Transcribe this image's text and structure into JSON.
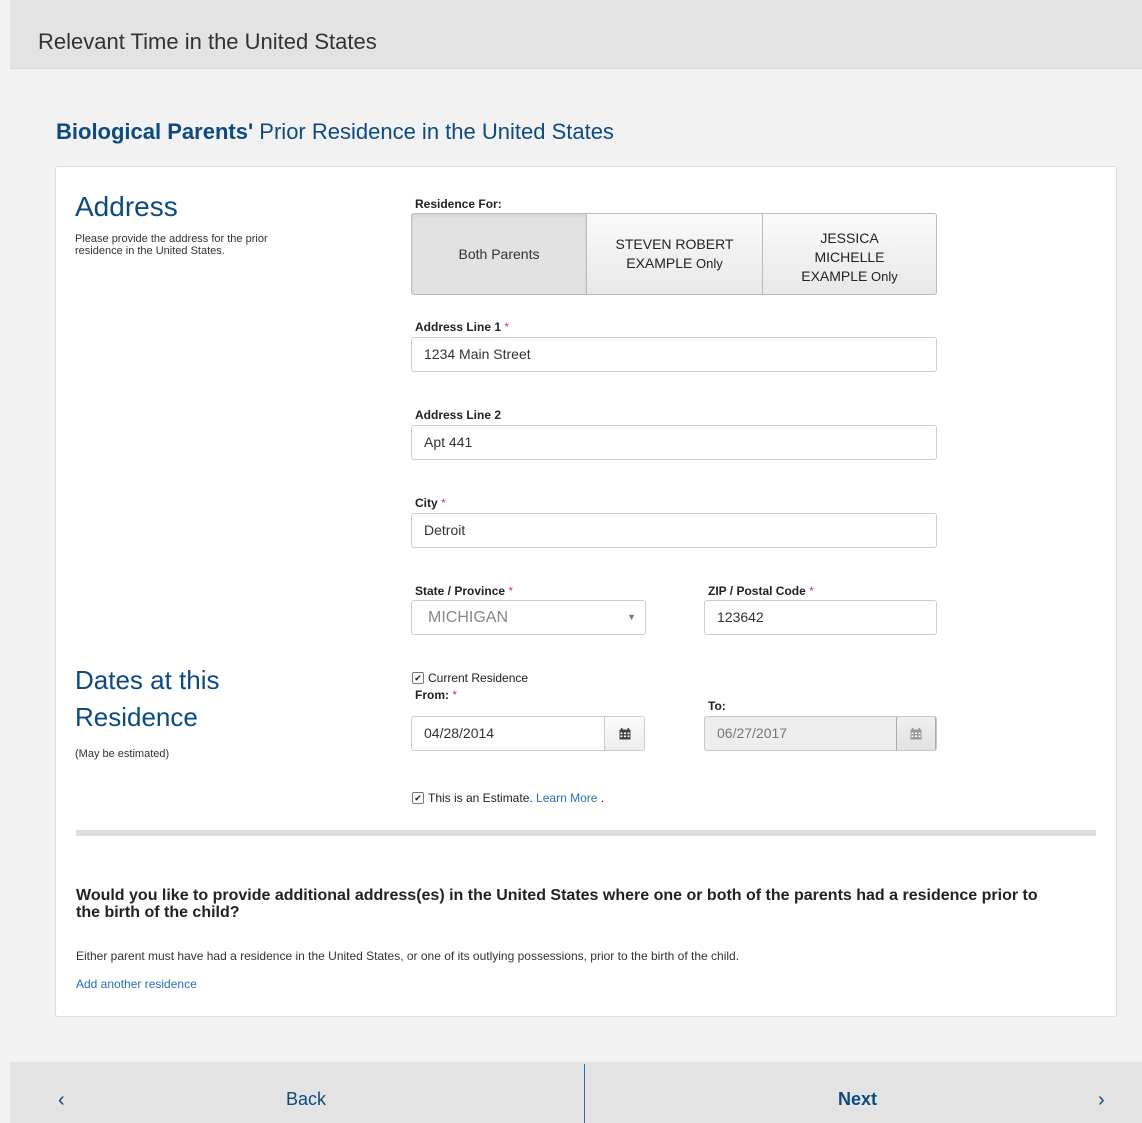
{
  "header": {
    "title": "Relevant Time in the United States"
  },
  "heading": {
    "bold": "Biological Parents'",
    "rest": " Prior Residence in the United States"
  },
  "address_section": {
    "title": "Address",
    "description": "Please provide the address for the prior residence in the United States."
  },
  "residence_for": {
    "label": "Residence For:",
    "options": [
      {
        "line1": "Both Parents",
        "line2": "",
        "suffix": "",
        "selected": true
      },
      {
        "line1": "STEVEN ROBERT",
        "line2": "EXAMPLE",
        "suffix": " Only",
        "selected": false
      },
      {
        "line1": "JESSICA MICHELLE",
        "line2": "EXAMPLE",
        "suffix": " Only",
        "selected": false
      }
    ]
  },
  "fields": {
    "address1": {
      "label": "Address Line 1",
      "required": "*",
      "value": "1234 Main Street"
    },
    "address2": {
      "label": "Address Line 2",
      "value": "Apt 441"
    },
    "city": {
      "label": "City",
      "required": "*",
      "value": "Detroit"
    },
    "state": {
      "label": "State / Province",
      "required": "*",
      "value": "MICHIGAN"
    },
    "zip": {
      "label": "ZIP / Postal Code",
      "required": "*",
      "value": "123642"
    }
  },
  "dates_section": {
    "title_line1": "Dates at this",
    "title_line2": "Residence",
    "subtitle": "(May be estimated)",
    "current_residence": {
      "label": "Current Residence",
      "checked": true
    },
    "from": {
      "label": "From:",
      "required": "*",
      "value": "04/28/2014"
    },
    "to": {
      "label": "To:",
      "value": "06/27/2017"
    },
    "estimate": {
      "label": "This is an Estimate.",
      "link": "Learn More",
      "after": " .",
      "checked": true
    }
  },
  "additional": {
    "question": "Would you like to provide additional address(es) in the United States where one or both of the parents had a residence prior to the birth of the child?",
    "note": "Either parent must have had a residence in the United States, or one of its outlying possessions, prior to the birth of the child.",
    "link": "Add another residence"
  },
  "footer": {
    "back": "Back",
    "next": "Next"
  },
  "icons": {
    "calendar": "calendar-icon",
    "caret": "caret-down-icon",
    "check": "checkmark-icon",
    "back": "chevron-left-icon",
    "next": "chevron-right-icon"
  },
  "colors": {
    "heading": "#0d4a80",
    "link": "#2a6fb5",
    "required": "#d9363e",
    "bar": "#e3e3e3"
  }
}
